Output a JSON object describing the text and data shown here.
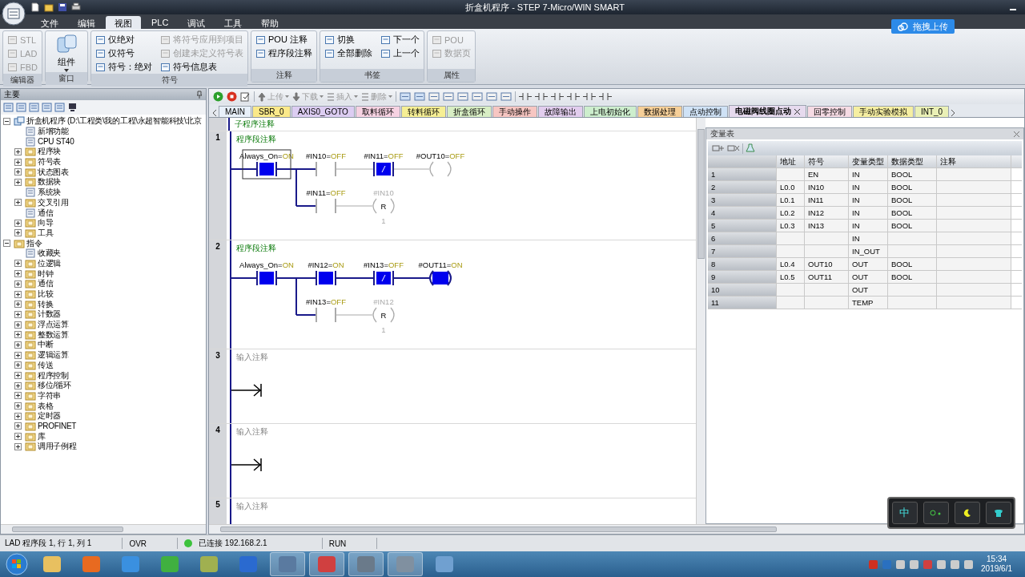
{
  "window": {
    "title": "折盒机程序 - STEP 7-Micro/WIN SMART"
  },
  "upload_button": {
    "label": "拖拽上传"
  },
  "ribbon": {
    "tabs": [
      {
        "label": "文件",
        "selected": false
      },
      {
        "label": "编辑",
        "selected": false
      },
      {
        "label": "视图",
        "selected": true
      },
      {
        "label": "PLC",
        "selected": false
      },
      {
        "label": "调试",
        "selected": false
      },
      {
        "label": "工具",
        "selected": false
      },
      {
        "label": "帮助",
        "selected": false
      }
    ],
    "groups": [
      {
        "title": "编辑器",
        "items": [
          {
            "label": "STL",
            "disabled": true,
            "kind": "small"
          },
          {
            "label": "LAD",
            "disabled": true,
            "kind": "small"
          },
          {
            "label": "FBD",
            "disabled": true,
            "kind": "small"
          }
        ]
      },
      {
        "title": "窗口",
        "items": [
          {
            "label": "组件",
            "disabled": false,
            "kind": "large"
          }
        ]
      },
      {
        "title": "符号",
        "items": [
          {
            "label": "仅绝对",
            "disabled": false,
            "kind": "small"
          },
          {
            "label": "仅符号",
            "disabled": false,
            "kind": "small"
          },
          {
            "label": "符号：绝对",
            "disabled": false,
            "kind": "small"
          },
          {
            "label": "将符号应用到项目",
            "disabled": true,
            "kind": "small"
          },
          {
            "label": "创建未定义符号表",
            "disabled": true,
            "kind": "small"
          },
          {
            "label": "符号信息表",
            "disabled": false,
            "kind": "small"
          }
        ]
      },
      {
        "title": "注释",
        "items": [
          {
            "label": "POU 注释",
            "disabled": false,
            "kind": "small"
          },
          {
            "label": "程序段注释",
            "disabled": false,
            "kind": "small"
          }
        ]
      },
      {
        "title": "书签",
        "items": [
          {
            "label": "切换",
            "disabled": false,
            "kind": "small"
          },
          {
            "label": "全部删除",
            "disabled": false,
            "kind": "small"
          },
          {
            "label": "下一个",
            "disabled": false,
            "kind": "small"
          },
          {
            "label": "上一个",
            "disabled": false,
            "kind": "small"
          }
        ]
      },
      {
        "title": "属性",
        "items": [
          {
            "label": "POU",
            "disabled": true,
            "kind": "small"
          },
          {
            "label": "数据页",
            "disabled": true,
            "kind": "small"
          }
        ]
      }
    ]
  },
  "project_panel": {
    "title": "主要",
    "items": [
      {
        "label": "折盒机程序 (D:\\工程类\\我的工程\\永超智能科技\\北京",
        "kind": "project",
        "expanded": true,
        "children": [
          {
            "label": "新增功能",
            "kind": "leaf"
          },
          {
            "label": "CPU ST40",
            "kind": "leaf"
          },
          {
            "label": "程序块",
            "kind": "folder",
            "expanded": false
          },
          {
            "label": "符号表",
            "kind": "folder",
            "expanded": false
          },
          {
            "label": "状态图表",
            "kind": "folder",
            "expanded": false
          },
          {
            "label": "数据块",
            "kind": "folder",
            "expanded": false
          },
          {
            "label": "系统块",
            "kind": "leaf"
          },
          {
            "label": "交叉引用",
            "kind": "folder",
            "expanded": false
          },
          {
            "label": "通信",
            "kind": "leaf"
          },
          {
            "label": "向导",
            "kind": "folder",
            "expanded": false
          },
          {
            "label": "工具",
            "kind": "folder",
            "expanded": false
          }
        ]
      },
      {
        "label": "指令",
        "kind": "folder",
        "expanded": true,
        "children": [
          {
            "label": "收藏夹",
            "kind": "leaf"
          },
          {
            "label": "位逻辑",
            "kind": "folder",
            "expanded": false
          },
          {
            "label": "时钟",
            "kind": "folder",
            "expanded": false
          },
          {
            "label": "通信",
            "kind": "folder",
            "expanded": false
          },
          {
            "label": "比较",
            "kind": "folder",
            "expanded": false
          },
          {
            "label": "转换",
            "kind": "folder",
            "expanded": false
          },
          {
            "label": "计数器",
            "kind": "folder",
            "expanded": false
          },
          {
            "label": "浮点运算",
            "kind": "folder",
            "expanded": false
          },
          {
            "label": "整数运算",
            "kind": "folder",
            "expanded": false
          },
          {
            "label": "中断",
            "kind": "folder",
            "expanded": false
          },
          {
            "label": "逻辑运算",
            "kind": "folder",
            "expanded": false
          },
          {
            "label": "传送",
            "kind": "folder",
            "expanded": false
          },
          {
            "label": "程序控制",
            "kind": "folder",
            "expanded": false
          },
          {
            "label": "移位/循环",
            "kind": "folder",
            "expanded": false
          },
          {
            "label": "字符串",
            "kind": "folder",
            "expanded": false
          },
          {
            "label": "表格",
            "kind": "folder",
            "expanded": false
          },
          {
            "label": "定时器",
            "kind": "folder",
            "expanded": false
          },
          {
            "label": "PROFINET",
            "kind": "folder",
            "expanded": false
          },
          {
            "label": "库",
            "kind": "folder",
            "expanded": false
          },
          {
            "label": "调用子例程",
            "kind": "folder",
            "expanded": false
          }
        ]
      }
    ]
  },
  "toolbar": {
    "buttons": [
      {
        "label": "上传",
        "disabled": true
      },
      {
        "label": "下载",
        "disabled": true
      },
      {
        "label": "插入",
        "disabled": true
      },
      {
        "label": "删除",
        "disabled": true
      }
    ]
  },
  "editor_tabs": [
    {
      "label": "MAIN",
      "color": "#e8f0fa",
      "selected": false
    },
    {
      "label": "SBR_0",
      "color": "#fbe98a",
      "selected": false
    },
    {
      "label": "AXIS0_GOTO",
      "color": "#dccdf2",
      "selected": false
    },
    {
      "label": "取料循环",
      "color": "#f6d2e2",
      "selected": false
    },
    {
      "label": "转料循环",
      "color": "#f6ef94",
      "selected": false
    },
    {
      "label": "折盒循环",
      "color": "#d8eec4",
      "selected": false
    },
    {
      "label": "手动操作",
      "color": "#f7c6c2",
      "selected": false
    },
    {
      "label": "故障输出",
      "color": "#e2cdee",
      "selected": false
    },
    {
      "label": "上电初始化",
      "color": "#cdeecd",
      "selected": false
    },
    {
      "label": "数据处理",
      "color": "#f6cf98",
      "selected": false
    },
    {
      "label": "点动控制",
      "color": "#cfe2f6",
      "selected": false
    },
    {
      "label": "电磁阀线圈点动",
      "color": "#e6daee",
      "selected": true
    },
    {
      "label": "回零控制",
      "color": "#f6dbe4",
      "selected": false
    },
    {
      "label": "手动实验模拟",
      "color": "#f6efa2",
      "selected": false
    },
    {
      "label": "INT_0",
      "color": "#eaf0b6",
      "selected": false
    }
  ],
  "ladder": {
    "header_comment": "子程序注释",
    "networks": [
      {
        "number": "1",
        "kind": "logic",
        "comment": "程序段注释",
        "rungs": [
          {
            "elements": [
              {
                "kind": "contact",
                "name": "Always_On=",
                "value": "ON",
                "active": true,
                "selected": true
              },
              {
                "kind": "contact",
                "name": "#IN10=",
                "value": "OFF",
                "active": false,
                "selected": false
              },
              {
                "kind": "closed_contact",
                "name": "#IN11=",
                "value": "OFF",
                "active": true,
                "selected": false
              },
              {
                "kind": "coil",
                "name": "#OUT10=",
                "value": "OFF",
                "active": false,
                "selected": false
              }
            ]
          },
          {
            "elements": [
              {
                "kind": "contact",
                "name": "#IN11=",
                "value": "OFF",
                "active": false,
                "selected": false
              },
              {
                "kind": "reset_coil",
                "name": "#IN10",
                "letter": "R",
                "count": "1",
                "active": false,
                "selected": false
              }
            ]
          }
        ]
      },
      {
        "number": "2",
        "kind": "logic",
        "comment": "程序段注释",
        "rungs": [
          {
            "elements": [
              {
                "kind": "contact",
                "name": "Always_On=",
                "value": "ON",
                "active": true,
                "selected": false
              },
              {
                "kind": "contact",
                "name": "#IN12=",
                "value": "ON",
                "active": true,
                "selected": false
              },
              {
                "kind": "closed_contact",
                "name": "#IN13=",
                "value": "OFF",
                "active": true,
                "selected": false
              },
              {
                "kind": "coil",
                "name": "#OUT11=",
                "value": "ON",
                "active": true,
                "selected": false
              }
            ]
          },
          {
            "elements": [
              {
                "kind": "contact",
                "name": "#IN13=",
                "value": "OFF",
                "active": false,
                "selected": false
              },
              {
                "kind": "reset_coil",
                "name": "#IN12",
                "letter": "R",
                "count": "1",
                "active": false,
                "selected": false
              }
            ]
          }
        ]
      },
      {
        "number": "3",
        "kind": "empty",
        "placeholder": "输入注释"
      },
      {
        "number": "4",
        "kind": "empty",
        "placeholder": "输入注释"
      },
      {
        "number": "5",
        "kind": "cut",
        "placeholder": "输入注释"
      }
    ]
  },
  "variable_table": {
    "title": "变量表",
    "columns": [
      "地址",
      "符号",
      "变量类型",
      "数据类型",
      "注释"
    ],
    "rows": [
      {
        "number": "1",
        "symbol": "EN",
        "var_type": "IN",
        "data_type": "BOOL"
      },
      {
        "number": "2",
        "address": "L0.0",
        "symbol": "IN10",
        "var_type": "IN",
        "data_type": "BOOL"
      },
      {
        "number": "3",
        "address": "L0.1",
        "symbol": "IN11",
        "var_type": "IN",
        "data_type": "BOOL"
      },
      {
        "number": "4",
        "address": "L0.2",
        "symbol": "IN12",
        "var_type": "IN",
        "data_type": "BOOL"
      },
      {
        "number": "5",
        "address": "L0.3",
        "symbol": "IN13",
        "var_type": "IN",
        "data_type": "BOOL"
      },
      {
        "number": "6",
        "var_type": "IN"
      },
      {
        "number": "7",
        "var_type": "IN_OUT"
      },
      {
        "number": "8",
        "address": "L0.4",
        "symbol": "OUT10",
        "var_type": "OUT",
        "data_type": "BOOL"
      },
      {
        "number": "9",
        "address": "L0.5",
        "symbol": "OUT11",
        "var_type": "OUT",
        "data_type": "BOOL"
      },
      {
        "number": "10",
        "var_type": "OUT"
      },
      {
        "number": "11",
        "var_type": "TEMP"
      }
    ]
  },
  "status_bar": {
    "position": "LAD 程序段 1, 行 1, 列 1",
    "mode": "OVR",
    "connected": true,
    "connection": "已连接 192.168.2.1",
    "plc_state": "RUN"
  },
  "ime_toolbar": {
    "language": "中"
  },
  "taskbar": {
    "time": "15:34",
    "date": "2019/6/1"
  }
}
